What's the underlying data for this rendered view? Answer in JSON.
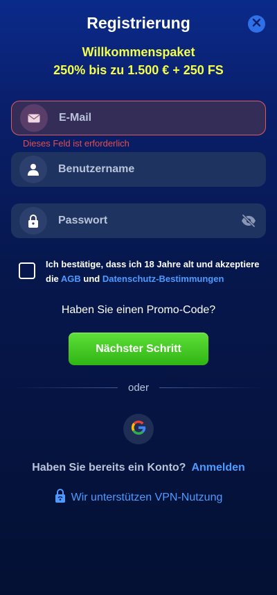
{
  "header": {
    "title": "Registrierung",
    "close_icon": "close-icon"
  },
  "promo": {
    "line1": "Willkommenspaket",
    "line2": "250% bis zu 1.500 € + 250 FS"
  },
  "form": {
    "email": {
      "placeholder": "E-Mail",
      "value": "",
      "icon": "mail-icon",
      "error": "Dieses Feld ist erforderlich"
    },
    "username": {
      "placeholder": "Benutzername",
      "value": "",
      "icon": "user-icon"
    },
    "password": {
      "placeholder": "Passwort",
      "value": "",
      "icon": "lock-icon",
      "toggle_icon": "eye-off-icon"
    }
  },
  "terms": {
    "text_part1": "Ich bestätige, dass ich 18 Jahre alt und akzeptiere die ",
    "link1": "AGB",
    "text_part2": " und ",
    "link2": "Datenschutz-Bestimmungen"
  },
  "promo_code_link": "Haben Sie einen Promo-Code?",
  "next_button": "Nächster Schritt",
  "divider_label": "oder",
  "social": {
    "google_icon": "google-icon"
  },
  "login": {
    "question": "Haben Sie bereits ein Konto?",
    "link": "Anmelden"
  },
  "vpn": {
    "icon": "vpn-lock-icon",
    "text": "Wir unterstützen VPN-Nutzung"
  },
  "colors": {
    "accent_blue": "#4e9bff",
    "promo_yellow": "#f4ff4a",
    "error_red": "#e34f4f",
    "button_green": "#3cc51f",
    "background": "#06174d"
  }
}
